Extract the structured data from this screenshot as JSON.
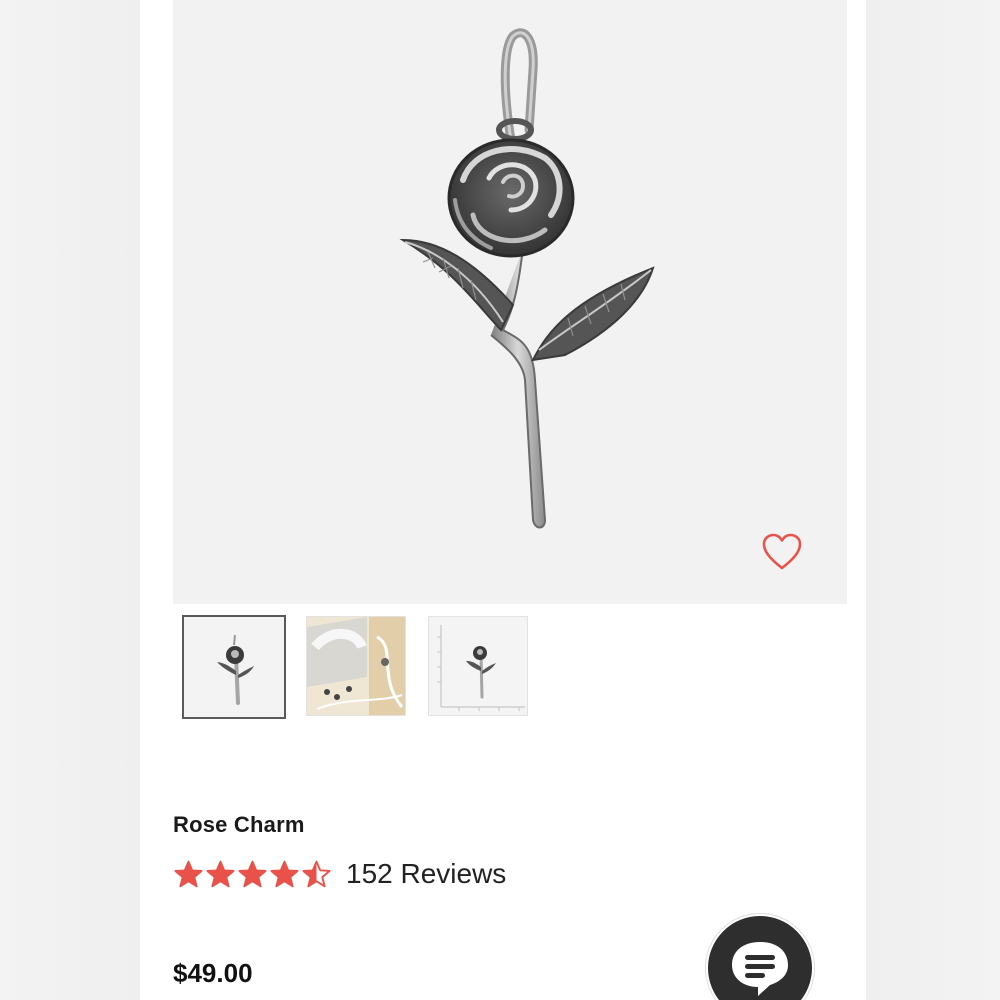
{
  "product": {
    "name": "Rose Charm",
    "rating": 4.5,
    "rating_max": 5,
    "reviews_label": "152 Reviews",
    "price": "$49.00"
  },
  "gallery": {
    "main_image": "rose-charm-silver",
    "thumbnails": [
      {
        "image": "rose-charm-front",
        "selected": true
      },
      {
        "image": "rose-charm-packaging",
        "selected": false
      },
      {
        "image": "rose-charm-size-ruler",
        "selected": false
      }
    ]
  },
  "icons": {
    "favorite": "heart-outline-icon",
    "chat": "chat-bubble-icon",
    "star": "star-icon"
  },
  "colors": {
    "star": "#e8524a",
    "heart": "#e8524a",
    "chat_bg": "#2e2e2e",
    "text": "#1a1a1a"
  }
}
